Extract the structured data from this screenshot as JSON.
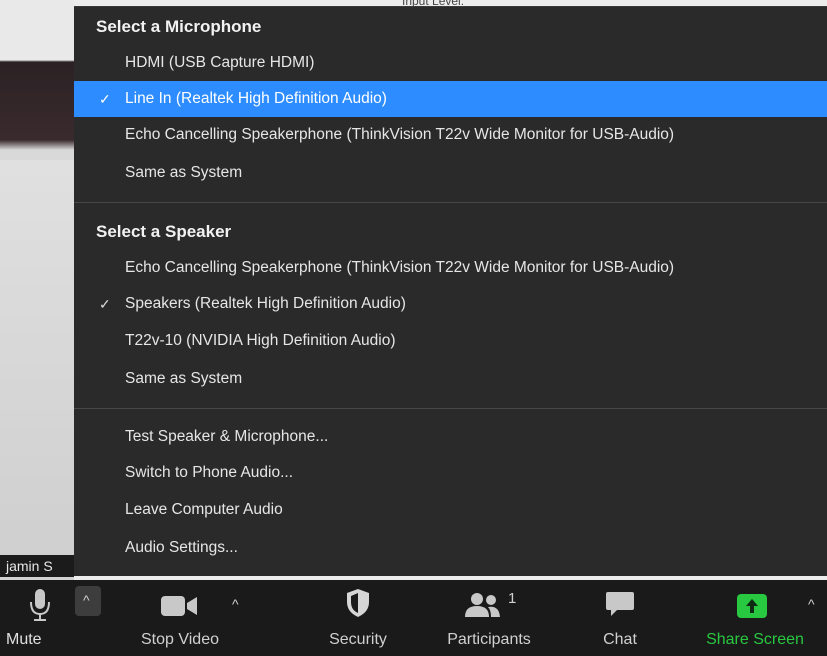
{
  "background": {
    "input_level_label": "Input Level:",
    "participant_name": "jamin S"
  },
  "menu": {
    "microphone_title": "Select a Microphone",
    "microphones": [
      {
        "label": "HDMI (USB Capture HDMI)",
        "selected": false
      },
      {
        "label": "Line In (Realtek High Definition Audio)",
        "selected": true
      },
      {
        "label": "Echo Cancelling Speakerphone (ThinkVision T22v Wide Monitor for USB-Audio)",
        "selected": false
      },
      {
        "label": "Same as System",
        "selected": false
      }
    ],
    "speaker_title": "Select a Speaker",
    "speakers": [
      {
        "label": "Echo Cancelling Speakerphone (ThinkVision T22v Wide Monitor for USB-Audio)",
        "selected": false
      },
      {
        "label": "Speakers (Realtek High Definition Audio)",
        "selected": true
      },
      {
        "label": "T22v-10 (NVIDIA High Definition Audio)",
        "selected": false
      },
      {
        "label": "Same as System",
        "selected": false
      }
    ],
    "actions": [
      {
        "label": "Test Speaker & Microphone..."
      },
      {
        "label": "Switch to Phone Audio..."
      },
      {
        "label": "Leave Computer Audio"
      },
      {
        "label": "Audio Settings..."
      }
    ],
    "check_glyph": "✓"
  },
  "toolbar": {
    "mute_label": "Mute",
    "stop_video_label": "Stop Video",
    "security_label": "Security",
    "participants_label": "Participants",
    "participants_count": "1",
    "chat_label": "Chat",
    "share_screen_label": "Share Screen",
    "caret_glyph": "^"
  },
  "colors": {
    "accent_blue": "#2d8cff",
    "share_green": "#28c840",
    "menu_bg": "#2a2a2a",
    "toolbar_bg": "#1a1a1a"
  }
}
